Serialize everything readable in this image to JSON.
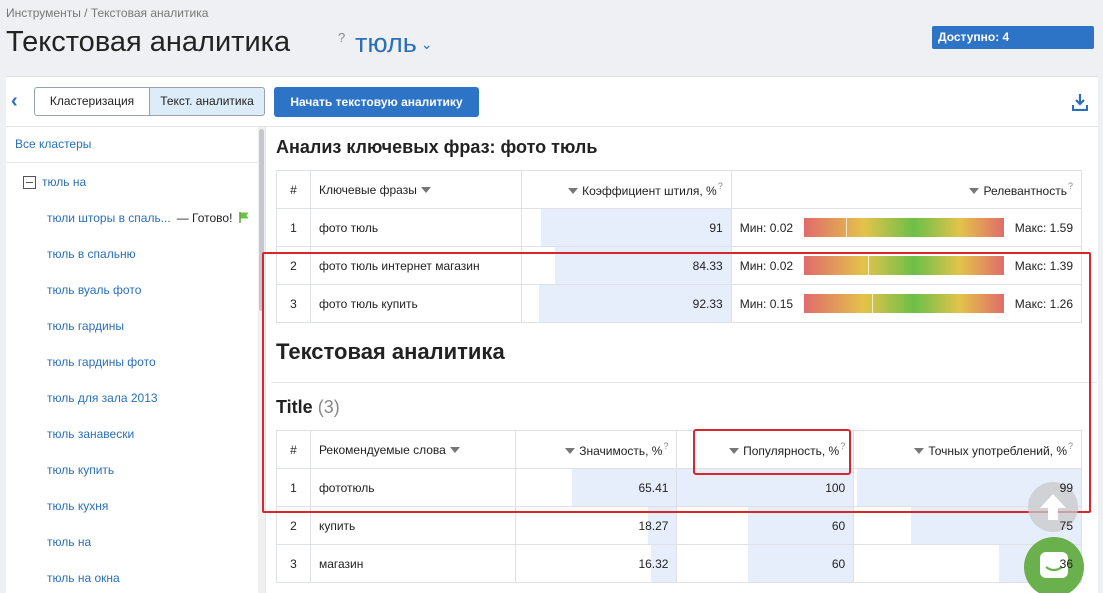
{
  "breadcrumb": "Инструменты / Текстовая аналитика",
  "header": {
    "title": "Текстовая аналитика",
    "help": "?",
    "project": "тюль",
    "available": "Доступно: 4"
  },
  "toolbar": {
    "seg_cluster": "Кластеризация",
    "seg_text": "Текст. аналитика",
    "start_button": "Начать текстовую аналитику"
  },
  "sidebar": {
    "all_clusters": "Все кластеры",
    "root": "тюль на",
    "items": [
      {
        "label": "тюли шторы в спаль...",
        "status": "— Готово!"
      },
      {
        "label": "тюль в спальню"
      },
      {
        "label": "тюль вуаль фото"
      },
      {
        "label": "тюль гардины"
      },
      {
        "label": "тюль гардины фото"
      },
      {
        "label": "тюль для зала 2013"
      },
      {
        "label": "тюль занавески"
      },
      {
        "label": "тюль купить"
      },
      {
        "label": "тюль кухня"
      },
      {
        "label": "тюль на"
      },
      {
        "label": "тюль на окна"
      }
    ]
  },
  "analysis": {
    "title": "Анализ ключевых фраз: фото тюль",
    "headers": {
      "num": "#",
      "phrase": "Ключевые фразы",
      "coef": "Коэффициент штиля, %",
      "relevance": "Релевантность"
    },
    "rows": [
      {
        "n": "1",
        "phrase": "фото тюль",
        "coef": "91",
        "coef_fill": 0.91,
        "min": "Мин: 0.02",
        "max": "Макс: 1.59",
        "mark": 0.21
      },
      {
        "n": "2",
        "phrase": "фото тюль интернет магазин",
        "coef": "84.33",
        "coef_fill": 0.84,
        "min": "Мин: 0.02",
        "max": "Макс: 1.39",
        "mark": 0.32
      },
      {
        "n": "3",
        "phrase": "фото тюль купить",
        "coef": "92.33",
        "coef_fill": 0.92,
        "min": "Мин: 0.15",
        "max": "Макс: 1.26",
        "mark": 0.34
      }
    ]
  },
  "text_analytics": {
    "title": "Текстовая аналитика",
    "section": "Title",
    "section_count": "(3)",
    "headers": {
      "num": "#",
      "word": "Рекомендуемые слова",
      "significance": "Значимость, %",
      "popularity": "Популярность, %",
      "exact": "Точных употреблений, %"
    },
    "rows": [
      {
        "n": "1",
        "word": "фототюль",
        "significance": "65.41",
        "sig_fill": 0.65,
        "popularity": "100",
        "pop_fill": 1.0,
        "exact": "99",
        "exact_fill": 0.99
      },
      {
        "n": "2",
        "word": "купить",
        "significance": "18.27",
        "sig_fill": 0.18,
        "popularity": "60",
        "pop_fill": 0.6,
        "exact": "75",
        "exact_fill": 0.75
      },
      {
        "n": "3",
        "word": "магазин",
        "significance": "16.32",
        "sig_fill": 0.16,
        "popularity": "60",
        "pop_fill": 0.6,
        "exact": "36",
        "exact_fill": 0.36
      }
    ]
  },
  "colors": {
    "accent": "#2d74c6",
    "highlight": "#d9262c",
    "link": "#2a6fb8",
    "chat": "#6ab04c"
  },
  "icons": {
    "back": "chevron-left-icon",
    "download": "download-icon",
    "flag": "flag-icon",
    "up": "arrow-up-icon",
    "chat": "chat-icon"
  }
}
